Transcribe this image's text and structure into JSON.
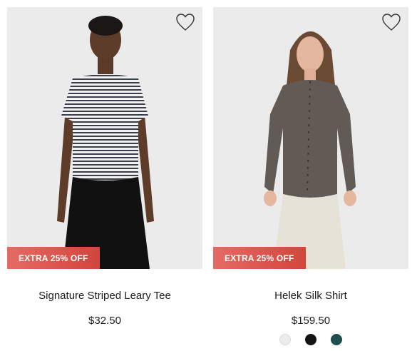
{
  "products": [
    {
      "name": "Signature Striped Leary Tee",
      "price": "$32.50",
      "badge": "EXTRA 25% OFF",
      "wishlist_icon": "heart-outline-icon",
      "photo_bg": "#ebebeb",
      "swatches": []
    },
    {
      "name": "Helek Silk Shirt",
      "price": "$159.50",
      "badge": "EXTRA 25% OFF",
      "wishlist_icon": "heart-outline-icon",
      "photo_bg": "#ebebeb",
      "swatches": [
        {
          "color": "#ececec"
        },
        {
          "color": "#141414"
        },
        {
          "color": "#1f4f4f"
        }
      ]
    }
  ],
  "colors": {
    "badge_start": "#e56a64",
    "badge_end": "#d2453d",
    "text": "#1d1d1d"
  }
}
